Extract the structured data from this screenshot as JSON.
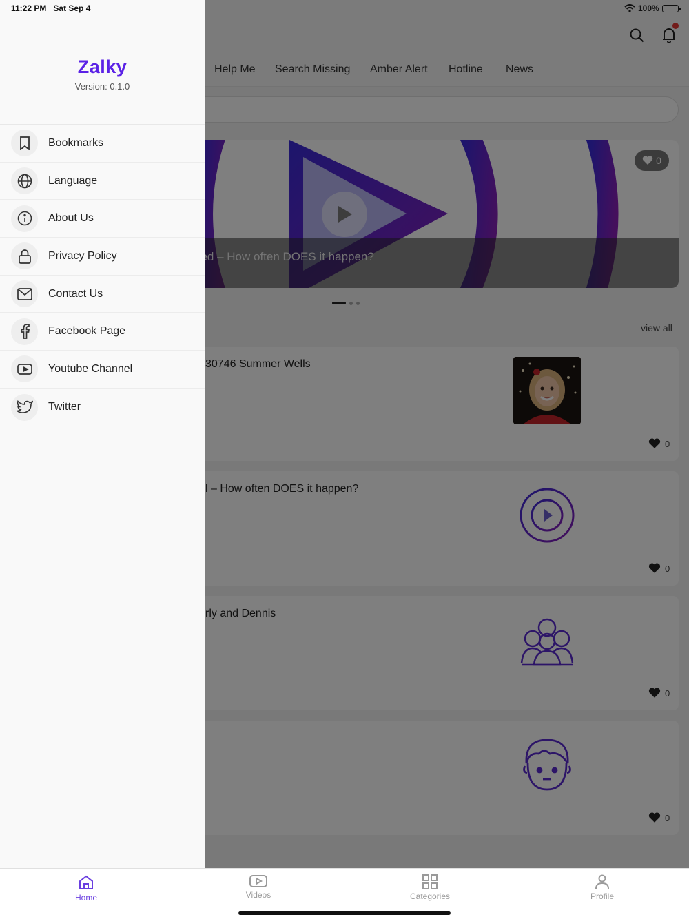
{
  "status_bar": {
    "time": "11:22 PM",
    "date": "Sat Sep 4",
    "battery_text": "100%"
  },
  "drawer": {
    "brand": "Zalky",
    "version": "Version: 0.1.0",
    "items": [
      {
        "label": "Bookmarks",
        "icon": "bookmark-icon"
      },
      {
        "label": "Language",
        "icon": "globe-icon"
      },
      {
        "label": "About Us",
        "icon": "info-icon"
      },
      {
        "label": "Privacy Policy",
        "icon": "lock-icon"
      },
      {
        "label": "Contact Us",
        "icon": "mail-icon"
      },
      {
        "label": "Facebook Page",
        "icon": "facebook-icon"
      },
      {
        "label": "Youtube Channel",
        "icon": "youtube-icon"
      },
      {
        "label": "Twitter",
        "icon": "twitter-icon"
      }
    ]
  },
  "header": {
    "tabs": [
      "Help Me",
      "Search Missing",
      "Amber Alert",
      "Hotline",
      "News"
    ]
  },
  "hero": {
    "caption": "bed – How often DOES it happen?",
    "likes": "0"
  },
  "section": {
    "view_all": "view all"
  },
  "cards": [
    {
      "title": "30746 Summer Wells",
      "likes": "0",
      "thumb": "child-photo"
    },
    {
      "title": "l – How often DOES it happen?",
      "likes": "0",
      "thumb": "play-circle-icon"
    },
    {
      "title": "rly and Dennis",
      "likes": "0",
      "thumb": "group-people-icon"
    },
    {
      "title": "",
      "likes": "0",
      "thumb": "boy-face-icon"
    }
  ],
  "bottom_nav": [
    {
      "label": "Home",
      "icon": "home-icon",
      "active": true
    },
    {
      "label": "Videos",
      "icon": "video-icon",
      "active": false
    },
    {
      "label": "Categories",
      "icon": "grid-icon",
      "active": false
    },
    {
      "label": "Profile",
      "icon": "user-icon",
      "active": false
    }
  ],
  "colors": {
    "brand": "#5b22e6",
    "accent_purple": "#6a3fe0",
    "gradient_start": "#3a2bd9",
    "gradient_end": "#8a1fb8",
    "notification": "#e53935"
  }
}
